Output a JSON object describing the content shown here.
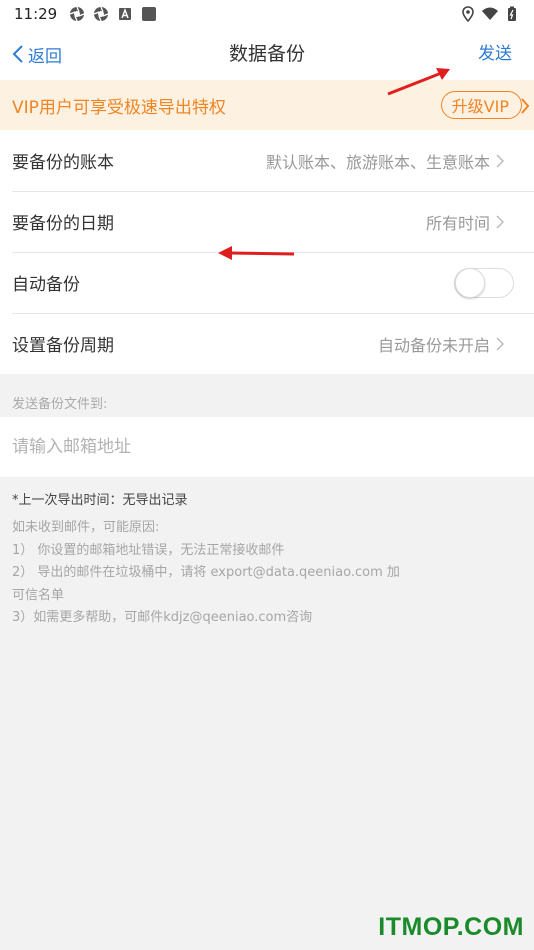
{
  "status_bar": {
    "time": "11:29",
    "icons_left": [
      "aperture-icon",
      "aperture-icon",
      "a-box-icon",
      "square-icon"
    ],
    "icons_right": [
      "location-icon",
      "wifi-icon",
      "battery-icon"
    ]
  },
  "nav": {
    "back_label": "返回",
    "title": "数据备份",
    "send_label": "发送"
  },
  "vip_banner": {
    "text": "VIP用户可享受极速导出特权",
    "upgrade_label": "升级VIP",
    "accent_color": "#f08525"
  },
  "settings": {
    "books": {
      "label": "要备份的账本",
      "value": "默认账本、旅游账本、生意账本"
    },
    "dates": {
      "label": "要备份的日期",
      "value": "所有时间"
    },
    "auto_backup": {
      "label": "自动备份",
      "enabled": false
    },
    "period": {
      "label": "设置备份周期",
      "value": "自动备份未开启"
    }
  },
  "email": {
    "caption": "发送备份文件到:",
    "placeholder": "请输入邮箱地址"
  },
  "last_export": "*上一次导出时间：无导出记录",
  "notes": [
    "如未收到邮件，可能原因:",
    "1） 你设置的邮箱地址错误，无法正常接收邮件",
    "2） 导出的邮件在垃圾桶中，请将 export@data.qeeniao.com 加",
    "可信名单",
    "3）如需更多帮助，可邮件kdjz@qeeniao.com咨询"
  ],
  "watermark": "ITMOP.COM",
  "colors": {
    "link_blue": "#2e7bd6",
    "annotation_red": "#e01e1e",
    "watermark_green": "#1a8a2a"
  }
}
